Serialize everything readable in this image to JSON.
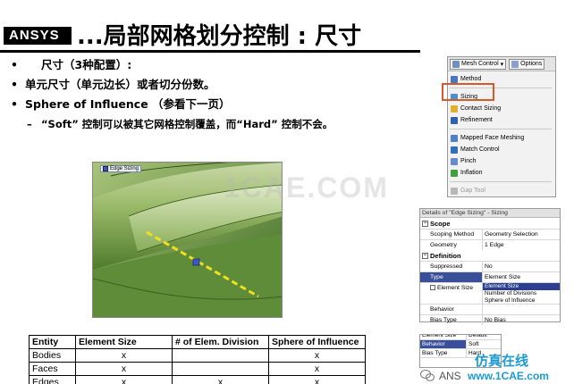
{
  "header": {
    "logo": "ANSYS",
    "title": "...局部网格划分控制 : 尺寸"
  },
  "bullets": [
    {
      "marker": "•",
      "text": "尺寸（3种配置）:",
      "level": "indent"
    },
    {
      "marker": "•",
      "text": "单元尺寸（单元边长）或者切分份数。"
    },
    {
      "marker": "•",
      "text_bold": "Sphere of Influence",
      "text_rest": "（参看下一页）"
    },
    {
      "marker": "–",
      "text": "“Soft” 控制可以被其它网格控制覆盖，而“Hard” 控制不会。",
      "level": "sub"
    }
  ],
  "model": {
    "tag": "Edge Sizing"
  },
  "watermark": "1CAE.COM",
  "menu": {
    "mesh_control_label": "Mesh Control",
    "options_label": "Options",
    "items": [
      {
        "label": "Method",
        "icon": "method-icon"
      },
      {
        "label": "Sizing",
        "icon": "sizing-icon",
        "highlighted": true
      },
      {
        "label": "Contact Sizing",
        "icon": "contact-sizing-icon"
      },
      {
        "label": "Refinement",
        "icon": "refinement-icon"
      },
      {
        "label": "Mapped Face Meshing",
        "icon": "mapped-face-icon"
      },
      {
        "label": "Match Control",
        "icon": "match-control-icon"
      },
      {
        "label": "Pinch",
        "icon": "pinch-icon"
      },
      {
        "label": "Inflation",
        "icon": "inflation-icon"
      },
      {
        "label": "Gap Tool",
        "icon": "gap-tool-icon",
        "disabled": true
      }
    ]
  },
  "details": {
    "title": "Details of \"Edge Sizing\" - Sizing",
    "scope_label": "Scope",
    "scoping_method_key": "Scoping Method",
    "scoping_method_val": "Geometry Selection",
    "geometry_key": "Geometry",
    "geometry_val": "1 Edge",
    "definition_label": "Definition",
    "suppressed_key": "Suppressed",
    "suppressed_val": "No",
    "type_key": "Type",
    "type_val": "Element Size",
    "element_size_key": "Element Size",
    "type_options": [
      "Element Size",
      "Number of Divisions",
      "Sphere of Influence"
    ],
    "behavior_key": "Behavior",
    "bias_type_key": "Bias Type",
    "bias_type_val": "No Bias"
  },
  "snippet": {
    "top_key": "Element Size",
    "top_val": "Default",
    "behavior_key": "Behavior",
    "behavior_val": "Soft",
    "bias_key": "Bias Type",
    "bias_val": "Hard"
  },
  "footer": {
    "brand": "仿真在线",
    "site": "www.1CAE.com",
    "small": "ANS"
  },
  "table": {
    "headers": [
      "Entity",
      "Element Size",
      "# of Elem. Division",
      "Sphere of Influence"
    ],
    "rows": [
      {
        "entity": "Bodies",
        "cells": [
          "x",
          "",
          "x"
        ]
      },
      {
        "entity": "Faces",
        "cells": [
          "x",
          "",
          "x"
        ]
      },
      {
        "entity": "Edges",
        "cells": [
          "x",
          "x",
          "x"
        ]
      }
    ]
  }
}
